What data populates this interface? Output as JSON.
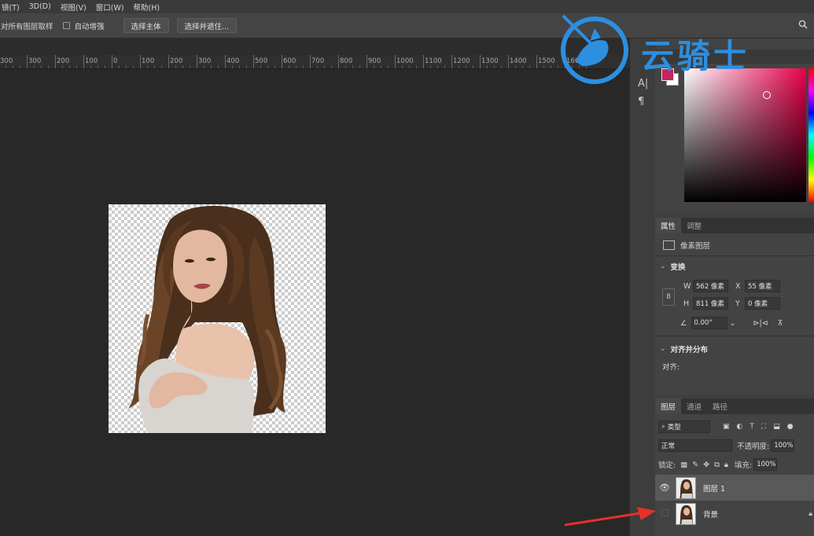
{
  "menubar": {
    "items": [
      "镜(T)",
      "3D(D)",
      "视图(V)",
      "窗口(W)",
      "帮助(H)"
    ]
  },
  "options": {
    "sample_all_layers": "对所有图层取样",
    "auto_enhance": "自动增强",
    "select_subject": "选择主体",
    "select_and_mask": "选择并遮住..."
  },
  "ruler": {
    "ticks": [
      "300",
      "300",
      "200",
      "100",
      "0",
      "100",
      "200",
      "300",
      "400",
      "500",
      "600",
      "700",
      "800",
      "900",
      "1000",
      "1100",
      "1200",
      "1300",
      "1400",
      "1500",
      "1600"
    ]
  },
  "watermark": {
    "text": "云骑士"
  },
  "color_panel": {
    "foreground": "#c2255f",
    "background": "#ffffff"
  },
  "properties": {
    "tab_properties": "属性",
    "tab_adjustments": "调整",
    "layer_type": "像素图层",
    "transform_title": "变换",
    "w_label": "W",
    "w_value": "562 像素",
    "x_label": "X",
    "x_value": "55 像素",
    "h_label": "H",
    "h_value": "811 像素",
    "y_label": "Y",
    "y_value": "0 像素",
    "angle_value": "0.00°",
    "align_title": "对齐并分布",
    "align_label": "对齐:"
  },
  "layers": {
    "tab_layers": "图层",
    "tab_channels": "通道",
    "tab_paths": "路径",
    "filter_kind": "类型",
    "blend_mode": "正常",
    "opacity_label": "不透明度:",
    "opacity_value": "100%",
    "lock_label": "锁定:",
    "fill_label": "填充:",
    "fill_value": "100%",
    "items": [
      {
        "name": "图层 1",
        "visible": true,
        "selected": true
      },
      {
        "name": "背景",
        "visible": false,
        "selected": false
      }
    ]
  },
  "colors": {
    "watermark_blue": "#2c8fe0",
    "arrow_red": "#e8302a"
  }
}
